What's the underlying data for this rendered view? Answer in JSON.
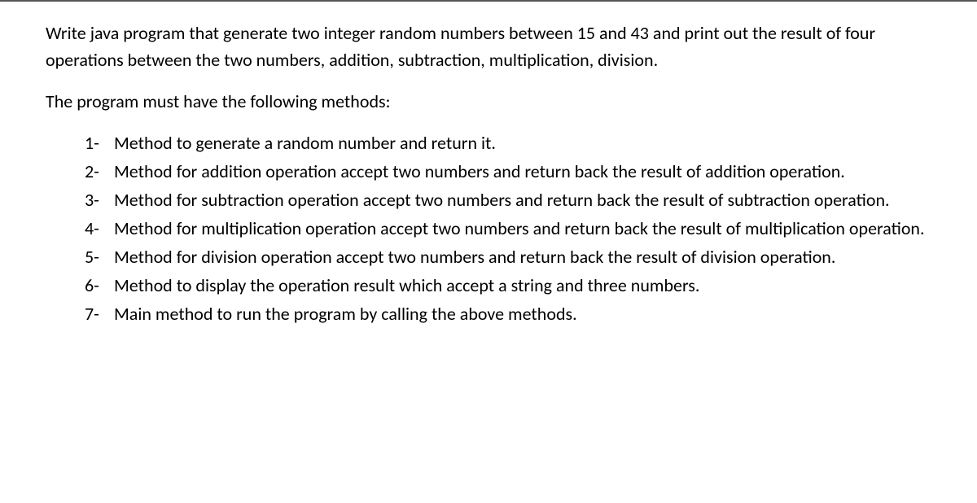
{
  "intro": "Write java program that generate two integer random numbers  between 15 and 43 and print out the result of four operations between the two numbers, addition, subtraction, multiplication, division.",
  "methods_heading": "The program must have the following methods:",
  "items": [
    {
      "num": "1-",
      "text": "Method to generate  a random number and return it."
    },
    {
      "num": "2-",
      "text": "Method for addition operation accept two numbers and return back the result of addition operation."
    },
    {
      "num": "3-",
      "text": "Method for subtraction operation accept two numbers and return back the result of subtraction operation."
    },
    {
      "num": "4-",
      "text": "Method for multiplication operation accept two numbers and return back the result of multiplication operation."
    },
    {
      "num": "5-",
      "text": "Method for division operation accept two numbers and return back the result of division operation."
    },
    {
      "num": "6-",
      "text": "Method to display the operation result which accept a string and three numbers."
    },
    {
      "num": "7-",
      "text": "Main method to run the program by calling the above methods."
    }
  ]
}
